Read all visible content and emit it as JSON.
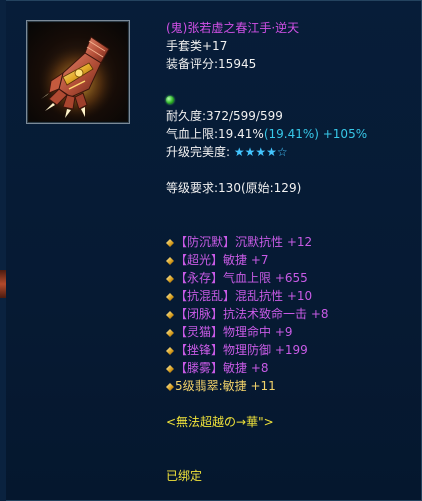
{
  "item": {
    "name": "(鬼)张若虚之春江手·逆天",
    "type_line": "手套类+17",
    "score_line": "装备评分:15945",
    "durability": "耐久度:372/599/599",
    "hp_label": "气血上限:19.41%",
    "hp_bonus": "(19.41%) +105%",
    "upgrade_label": "升级完美度:",
    "upgrade_stars": "★★★★☆",
    "level_req": "等级要求:130(原始:129)",
    "gem_lines": [
      "【防沉默】沉默抗性 +12",
      "【超光】敏捷 +7",
      "【永存】气血上限 +655",
      "【抗混乱】混乱抗性 +10",
      "【闭脉】抗法术致命一击 +8",
      "【灵猫】物理命中 +9",
      "【挫锋】物理防御 +199",
      "【滕雾】敏捷 +8"
    ],
    "jade_line": "5级翡翠:敏捷 +11",
    "engrave": "<無法超越の→華\">",
    "bound": "已绑定"
  },
  "colors": {
    "title": "#d150e6",
    "gem_text": "#c85be6",
    "engrave": "#f0e23a",
    "stars": "#43c6ff",
    "cyan_bonus": "#37c8e8"
  },
  "icons": {
    "item": "gauntlet-icon",
    "durability": "green-orb-icon",
    "gem_bullet": "gem-icon"
  }
}
